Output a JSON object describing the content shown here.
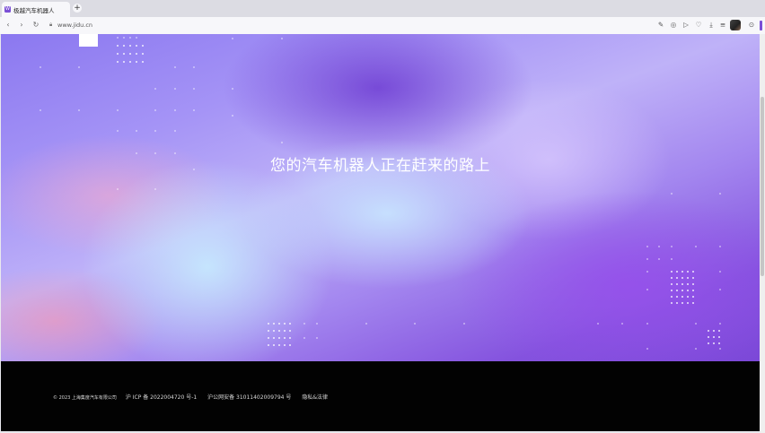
{
  "browser": {
    "tab": {
      "favicon_letter": "W",
      "title": "极越汽车机器人"
    },
    "new_tab": "+",
    "address": {
      "url": "www.jidu.cn"
    },
    "accent_color": "#7b4fd6"
  },
  "page": {
    "headline": "您的汽车机器人正在赶来的路上",
    "footer": {
      "copyright": "© 2023 上海集度汽车有限公司",
      "icp": "沪 ICP 备 2022004720 号-1",
      "police_record": "沪公网安备 31011402009794 号",
      "privacy_link": "隐私&法律"
    }
  },
  "icons": {
    "back": "back-arrow-icon",
    "forward": "forward-arrow-icon",
    "reload": "reload-icon",
    "lock": "lock-icon",
    "toolbar": [
      "edit-icon",
      "screenshot-icon",
      "play-icon",
      "heart-icon",
      "download-icon",
      "menu-icon",
      "avatar",
      "extension-icon"
    ]
  }
}
